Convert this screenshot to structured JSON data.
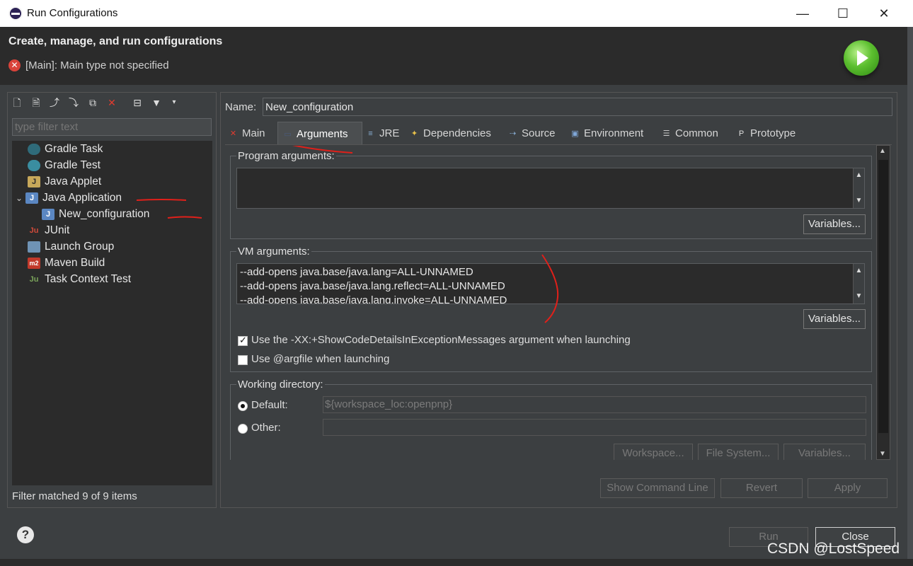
{
  "window": {
    "title": "Run Configurations",
    "controls": {
      "minimize": "—",
      "maximize": "☐",
      "close": "✕"
    }
  },
  "header": {
    "title": "Create, manage, and run configurations",
    "error_message": "[Main]: Main type not specified",
    "error_icon": "✕"
  },
  "left": {
    "filter_placeholder": "type filter text",
    "tree": [
      {
        "label": "Gradle Task",
        "icon": "gradle-elephant-icon"
      },
      {
        "label": "Gradle Test",
        "icon": "gradle-elephant-icon"
      },
      {
        "label": "Java Applet",
        "icon": "java-applet-icon"
      },
      {
        "label": "Java Application",
        "icon": "java-application-icon",
        "expanded": true
      },
      {
        "label": "New_configuration",
        "icon": "java-config-icon",
        "selected": true
      },
      {
        "label": "JUnit",
        "icon": "junit-icon"
      },
      {
        "label": "Launch Group",
        "icon": "launch-group-icon"
      },
      {
        "label": "Maven Build",
        "icon": "maven-icon"
      },
      {
        "label": "Task Context Test",
        "icon": "task-context-icon"
      }
    ],
    "expand_glyph": "⌄",
    "filter_status": "Filter matched 9 of 9 items"
  },
  "right": {
    "name_label": "Name:",
    "name_value": "New_configuration",
    "tabs": [
      "Main",
      "Arguments",
      "JRE",
      "Dependencies",
      "Source",
      "Environment",
      "Common",
      "Prototype"
    ],
    "active_tab": "Arguments",
    "program_args": {
      "label": "Program arguments:",
      "value": "",
      "variables_button": "Variables..."
    },
    "vm_args": {
      "label": "VM arguments:",
      "lines": [
        "--add-opens java.base/java.lang=ALL-UNNAMED",
        "--add-opens java.base/java.lang.reflect=ALL-UNNAMED",
        "--add-opens java.base/java.lang.invoke=ALL-UNNAMED"
      ],
      "variables_button": "Variables...",
      "show_code_details": {
        "label": "Use the -XX:+ShowCodeDetailsInExceptionMessages argument when launching",
        "checked": true
      },
      "argfile": {
        "label": "Use @argfile when launching",
        "checked": false
      }
    },
    "working_dir": {
      "label": "Working directory:",
      "default_label": "Default:",
      "default_value": "${workspace_loc:openpnp}",
      "default_selected": true,
      "other_label": "Other:",
      "other_value": "",
      "buttons": [
        "Workspace...",
        "File System...",
        "Variables..."
      ]
    },
    "footer_buttons": [
      "Show Command Line",
      "Revert",
      "Apply"
    ]
  },
  "dialog_buttons": {
    "run": "Run",
    "close": "Close",
    "help": "?"
  },
  "watermark": "CSDN @LostSpeed",
  "colors": {
    "background": "#3c3f41",
    "dark": "#2b2b2b",
    "annotation_red": "#e0201a",
    "run_green": "#5cbf2f",
    "error_red": "#d9433a"
  }
}
